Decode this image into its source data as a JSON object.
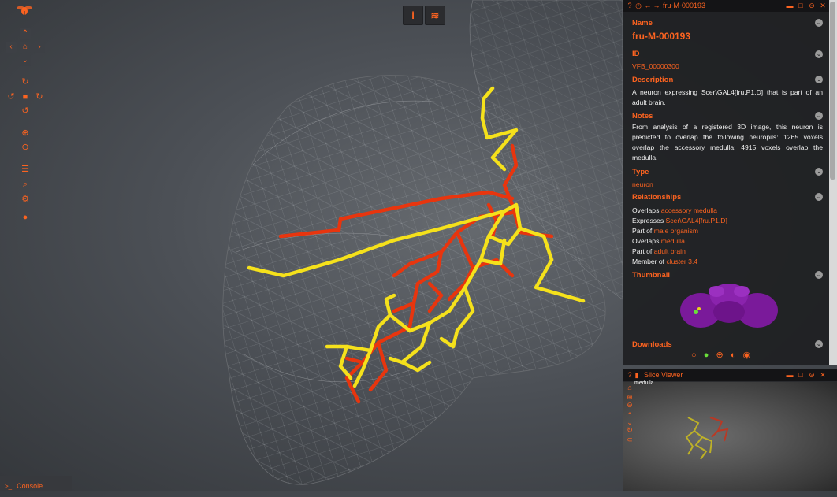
{
  "colors": {
    "accent": "#fc6320",
    "panel_bg": "#1e1f22",
    "neuron_red": "#e8350e",
    "neuron_yellow": "#f5e11b",
    "brain_purple": "#7a1a9a"
  },
  "toolbar": {
    "logo_icon": "fly-icon",
    "icons": [
      "pan-up-icon",
      "pan-left-icon",
      "home-icon",
      "pan-right-icon",
      "pan-down-icon",
      "rotate-up-icon",
      "rotate-left-icon",
      "camera-icon",
      "rotate-right-icon",
      "rotate-down-icon",
      "zoom-in-icon",
      "zoom-out-icon",
      "list-icon",
      "search-icon",
      "settings-icon",
      "github-icon"
    ]
  },
  "top_buttons": {
    "info": "i",
    "layers": "≋"
  },
  "info_panel": {
    "header_title": "fru-M-000193",
    "name_label": "Name",
    "name_value": "fru-M-000193",
    "id_label": "ID",
    "id_value": "VFB_00000300",
    "description_label": "Description",
    "description_value": "A neuron expressing Scer\\GAL4[fru.P1.D] that is part of an adult brain.",
    "notes_label": "Notes",
    "notes_value": "From analysis of a registered 3D image, this neuron is predicted to overlap the following neuropils: 1265 voxels overlap the accessory medulla; 4915 voxels overlap the medulla.",
    "type_label": "Type",
    "type_value": "neuron",
    "relationships_label": "Relationships",
    "relationships": [
      {
        "rel": "Overlaps",
        "target": "accessory medulla"
      },
      {
        "rel": "Expresses",
        "target": "Scer\\GAL4[fru.P1.D]"
      },
      {
        "rel": "Part of",
        "target": "male organism"
      },
      {
        "rel": "Overlaps",
        "target": "medulla"
      },
      {
        "rel": "Part of",
        "target": "adult brain"
      },
      {
        "rel": "Member of",
        "target": "cluster 3.4"
      }
    ],
    "thumbnail_label": "Thumbnail",
    "downloads_label": "Downloads"
  },
  "slice_viewer": {
    "header_title": "Slice Viewer",
    "region_label": "medulla"
  },
  "console": {
    "label": "Console",
    "prompt": ">_"
  }
}
